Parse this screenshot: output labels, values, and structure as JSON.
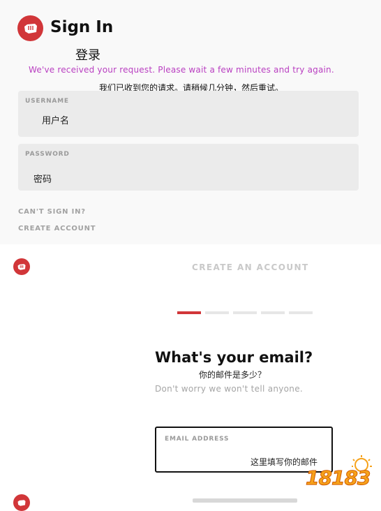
{
  "signin": {
    "title": "Sign In",
    "title_cn": "登录",
    "error_message": "We've received your request. Please wait a few minutes and try again.",
    "error_message_cn": "我们已收到您的请求。请稍候几分钟，然后重试。",
    "username": {
      "label": "USERNAME",
      "value": "用户名"
    },
    "password": {
      "label": "PASSWORD",
      "value": "密码"
    },
    "cant_sign_in": "CAN'T SIGN IN?",
    "create_account": "CREATE ACCOUNT"
  },
  "signup": {
    "header": "CREATE AN ACCOUNT",
    "steps": 5,
    "active_step": 1,
    "heading": "What's your email?",
    "heading_cn": "你的邮件是多少？",
    "subtext": "Don't worry we won't tell anyone.",
    "email": {
      "label": "EMAIL ADDRESS",
      "value": "这里填写你的邮件"
    }
  },
  "watermark": {
    "text": "18183"
  },
  "colors": {
    "brand": "#d13639",
    "error": "#b93fc1",
    "field_bg": "#ebebeb"
  }
}
